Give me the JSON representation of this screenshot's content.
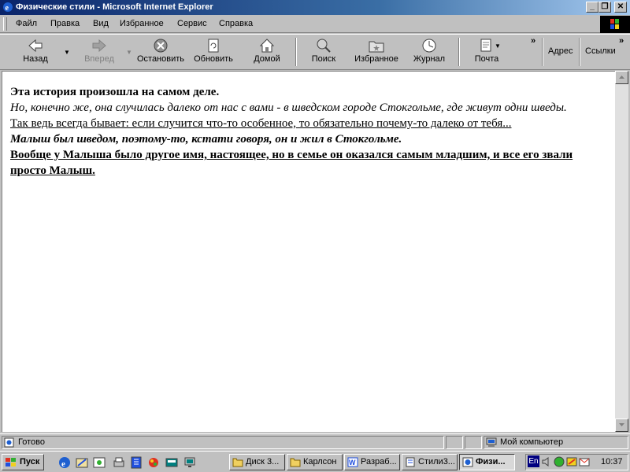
{
  "window": {
    "title": "Физические стили - Microsoft Internet Explorer"
  },
  "menu": [
    "Файл",
    "Правка",
    "Вид",
    "Избранное",
    "Сервис",
    "Справка"
  ],
  "toolbar": {
    "back": "Назад",
    "forward": "Вперед",
    "stop": "Остановить",
    "refresh": "Обновить",
    "home": "Домой",
    "search": "Поиск",
    "favorites": "Избранное",
    "history": "Журнал",
    "mail": "Почта",
    "address": "Адрес",
    "links": "Ссылки",
    "more": "»"
  },
  "content": {
    "lines": [
      "Эта история произошла на самом деле.",
      "Но, конечно же, она случилась далеко от нас с вами - в шведском городе Стокгольме, где живут одни шведы.",
      "Так ведь всегда бывает: если случится что-то особенное, то обязательно почему-то далеко от тебя...",
      "Малыш был шведом, поэтому-то, кстати говоря, он и жил в Стокгольме.",
      "Вообще у Малыша было другое имя, настоящее, но в семье он оказался самым младшим, и все его звали просто Малыш."
    ]
  },
  "status": {
    "text": "Готово",
    "zone": "Мой компьютер"
  },
  "taskbar": {
    "start": "Пуск",
    "tasks": [
      "Диск 3...",
      "Карлсон",
      "Разраб...",
      "Стили3...",
      "Физи..."
    ],
    "lang": "En",
    "clock": "10:37"
  },
  "colors": {
    "title_start": "#0a246a",
    "title_end": "#a6caf0",
    "link": "#000080"
  }
}
